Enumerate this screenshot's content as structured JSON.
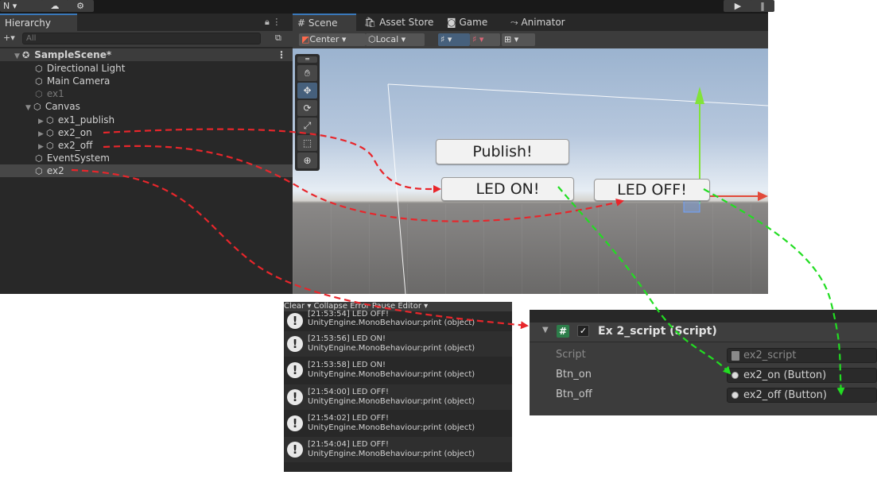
{
  "toolbar": {
    "account_label": "N ▾"
  },
  "hierarchy": {
    "tab_label": "Hierarchy",
    "search_placeholder": "All",
    "scene_name": "SampleScene*",
    "items": [
      {
        "label": "Directional Light"
      },
      {
        "label": "Main Camera"
      },
      {
        "label": "ex1"
      },
      {
        "label": "Canvas"
      },
      {
        "label": "ex1_publish"
      },
      {
        "label": "ex2_on"
      },
      {
        "label": "ex2_off"
      },
      {
        "label": "EventSystem"
      },
      {
        "label": "ex2"
      }
    ]
  },
  "scene": {
    "tabs": [
      "Scene",
      "Asset Store",
      "Game",
      "Animator"
    ],
    "pivot_label": "Center",
    "space_label": "Local",
    "buttons": [
      "Publish!",
      "LED ON!",
      "LED OFF!"
    ]
  },
  "console": {
    "toolbar_text": "Clear  ▾  Collapse   Error Pause   Editor ▾",
    "logs": [
      {
        "time_msg": "[21:53:54] LED OFF!",
        "source": "UnityEngine.MonoBehaviour:print (object)"
      },
      {
        "time_msg": "[21:53:56] LED ON!",
        "source": "UnityEngine.MonoBehaviour:print (object)"
      },
      {
        "time_msg": "[21:53:58] LED ON!",
        "source": "UnityEngine.MonoBehaviour:print (object)"
      },
      {
        "time_msg": "[21:54:00] LED OFF!",
        "source": "UnityEngine.MonoBehaviour:print (object)"
      },
      {
        "time_msg": "[21:54:02] LED OFF!",
        "source": "UnityEngine.MonoBehaviour:print (object)"
      },
      {
        "time_msg": "[21:54:04] LED OFF!",
        "source": "UnityEngine.MonoBehaviour:print (object)"
      }
    ]
  },
  "inspector": {
    "component_title": "Ex 2_script (Script)",
    "fields": [
      {
        "label": "Script",
        "value": "ex2_script"
      },
      {
        "label": "Btn_on",
        "value": "ex2_on (Button)"
      },
      {
        "label": "Btn_off",
        "value": "ex2_off (Button)"
      }
    ]
  },
  "colors": {
    "red_arrow": "#e8262b",
    "green_arrow": "#22dd22",
    "accent": "#3a79bb"
  }
}
